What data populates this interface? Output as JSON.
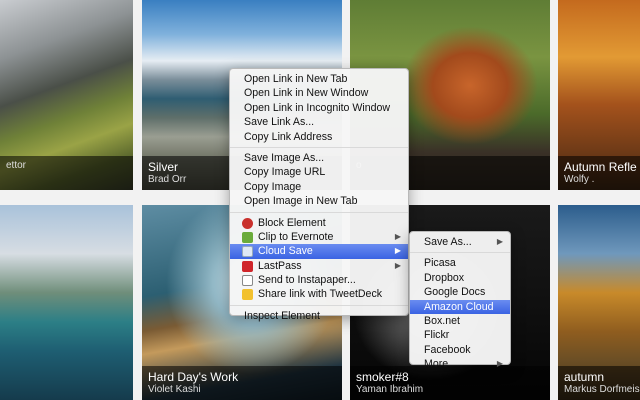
{
  "tiles": [
    {
      "title": "",
      "author": "ettor"
    },
    {
      "title": "Silver",
      "author": "Brad Orr"
    },
    {
      "title": "",
      "author": "o"
    },
    {
      "title": "Autumn Refle",
      "author": "Wolfy ."
    },
    {
      "title": "",
      "author": ""
    },
    {
      "title": "Hard Day's Work",
      "author": "Violet Kashi"
    },
    {
      "title": "smoker#8",
      "author": "Yaman Ibrahim"
    },
    {
      "title": "autumn",
      "author": "Markus Dorfmeis"
    }
  ],
  "context_menu": {
    "open_new_tab": "Open Link in New Tab",
    "open_new_window": "Open Link in New Window",
    "open_incognito": "Open Link in Incognito Window",
    "save_link_as": "Save Link As...",
    "copy_link_address": "Copy Link Address",
    "save_image_as": "Save Image As...",
    "copy_image_url": "Copy Image URL",
    "copy_image": "Copy Image",
    "open_image_new_tab": "Open Image in New Tab",
    "block_element": "Block Element",
    "clip_to_evernote": "Clip to Evernote",
    "cloud_save": "Cloud Save",
    "lastpass": "LastPass",
    "send_to_instapaper": "Send to Instapaper...",
    "share_tweetdeck": "Share link with TweetDeck",
    "inspect_element": "Inspect Element"
  },
  "submenu": {
    "save_as": "Save As...",
    "picasa": "Picasa",
    "dropbox": "Dropbox",
    "google_docs": "Google Docs",
    "amazon_cloud": "Amazon Cloud",
    "box_net": "Box.net",
    "flickr": "Flickr",
    "facebook": "Facebook",
    "more": "More"
  },
  "icons": {
    "block": "block-icon",
    "evernote": "evernote-icon",
    "cloud_save": "cloud-save-icon",
    "lastpass": "lastpass-icon",
    "instapaper": "instapaper-icon",
    "tweetdeck": "tweetdeck-icon",
    "arrow": "chevron-right-icon"
  },
  "colors": {
    "highlight": "#3a63e3",
    "block_icon": "#c9302c",
    "evernote_icon": "#6aab3a",
    "lastpass_icon": "#d0262b",
    "tweetdeck_icon": "#f2c12e"
  }
}
